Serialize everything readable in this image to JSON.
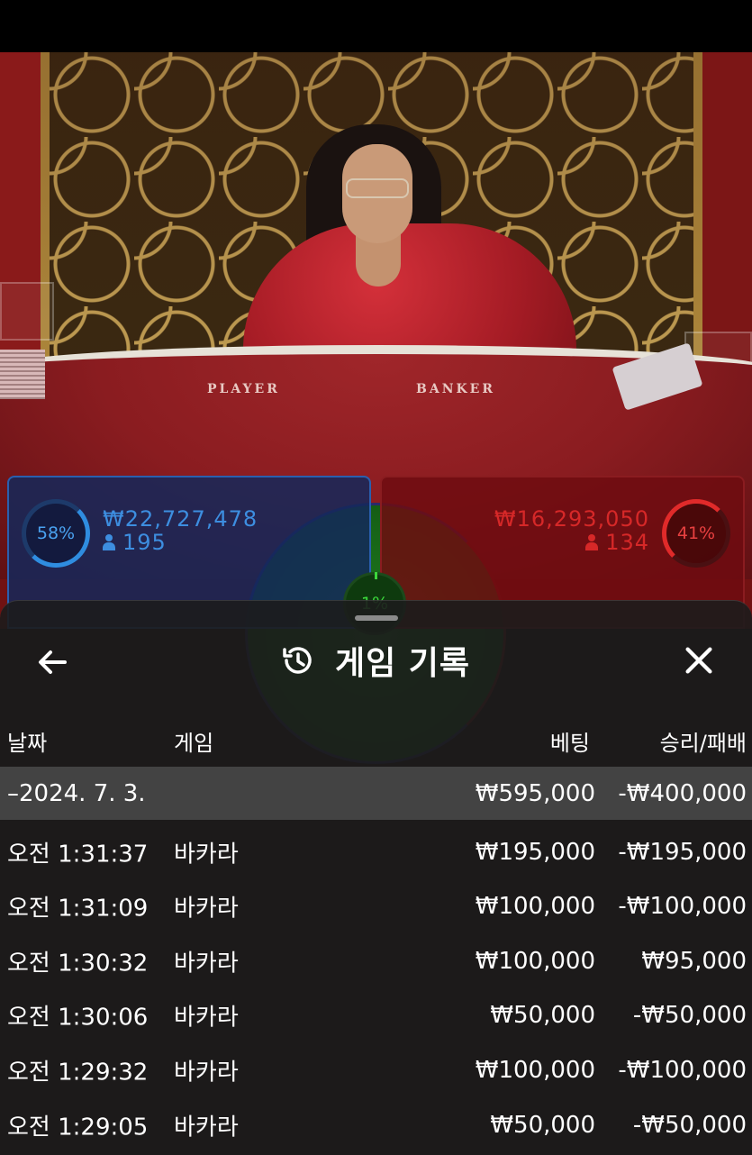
{
  "table": {
    "player_label": "PLAYER",
    "banker_label": "BANKER"
  },
  "bets": {
    "player": {
      "percent": "58%",
      "amount": "₩22,727,478",
      "count": "195",
      "color": "#3d8ee0"
    },
    "banker": {
      "percent": "41%",
      "amount": "₩16,293,050",
      "count": "134",
      "color": "#d62828"
    },
    "tie": {
      "percent": "1%",
      "color": "#3cd83c"
    }
  },
  "sheet": {
    "title": "게임 기록",
    "back_icon": "back-arrow-icon",
    "history_icon": "history-icon",
    "close_icon": "close-icon",
    "columns": {
      "date": "날짜",
      "game": "게임",
      "bet": "베팅",
      "result": "승리/패배"
    },
    "date_group": {
      "date": "–2024. 7. 3.",
      "bet": "₩595,000",
      "result": "-₩400,000"
    },
    "rows": [
      {
        "time": "오전 1:31:37",
        "game": "바카라",
        "bet": "₩195,000",
        "result": "-₩195,000"
      },
      {
        "time": "오전 1:31:09",
        "game": "바카라",
        "bet": "₩100,000",
        "result": "-₩100,000"
      },
      {
        "time": "오전 1:30:32",
        "game": "바카라",
        "bet": "₩100,000",
        "result": "₩95,000"
      },
      {
        "time": "오전 1:30:06",
        "game": "바카라",
        "bet": "₩50,000",
        "result": "-₩50,000"
      },
      {
        "time": "오전 1:29:32",
        "game": "바카라",
        "bet": "₩100,000",
        "result": "-₩100,000"
      },
      {
        "time": "오전 1:29:05",
        "game": "바카라",
        "bet": "₩50,000",
        "result": "-₩50,000"
      }
    ]
  }
}
